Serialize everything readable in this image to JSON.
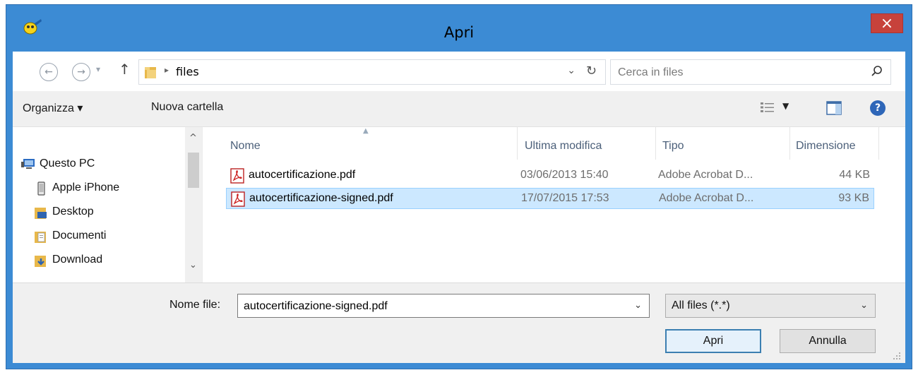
{
  "window": {
    "title": "Apri",
    "close_glyph": "×",
    "frame_color": "#3c8bd4",
    "close_color": "#c7423b"
  },
  "navigation": {
    "back_icon": "back-arrow-icon",
    "forward_icon": "forward-arrow-icon",
    "up_icon": "up-arrow-icon"
  },
  "address": {
    "path": "files",
    "refresh_icon": "refresh-icon"
  },
  "search": {
    "placeholder": "Cerca in files",
    "icon": "search-icon"
  },
  "toolbar": {
    "organize_label": "Organizza ▾",
    "new_folder_label": "Nuova cartella",
    "view_icon": "view-list-icon",
    "preview_icon": "preview-pane-icon",
    "help_icon": "help-icon"
  },
  "sidebar": {
    "items": [
      {
        "label": "Questo PC",
        "icon": "computer-icon"
      },
      {
        "label": "Apple iPhone",
        "icon": "phone-icon"
      },
      {
        "label": "Desktop",
        "icon": "desktop-folder-icon"
      },
      {
        "label": "Documenti",
        "icon": "documents-folder-icon"
      },
      {
        "label": "Download",
        "icon": "download-folder-icon"
      }
    ]
  },
  "file_list": {
    "columns": [
      "Nome",
      "Ultima modifica",
      "Tipo",
      "Dimensione"
    ],
    "rows": [
      {
        "name": "autocertificazione.pdf",
        "modified": "03/06/2013 15:40",
        "type": "Adobe Acrobat D...",
        "size": "44 KB",
        "selected": false
      },
      {
        "name": "autocertificazione-signed.pdf",
        "modified": "17/07/2015 17:53",
        "type": "Adobe Acrobat D...",
        "size": "93 KB",
        "selected": true
      }
    ],
    "selection_color": "#cce8ff"
  },
  "footer": {
    "filename_label": "Nome file:",
    "filename_value": "autocertificazione-signed.pdf",
    "filter_value": "All files (*.*)",
    "open_label": "Apri",
    "cancel_label": "Annulla"
  }
}
